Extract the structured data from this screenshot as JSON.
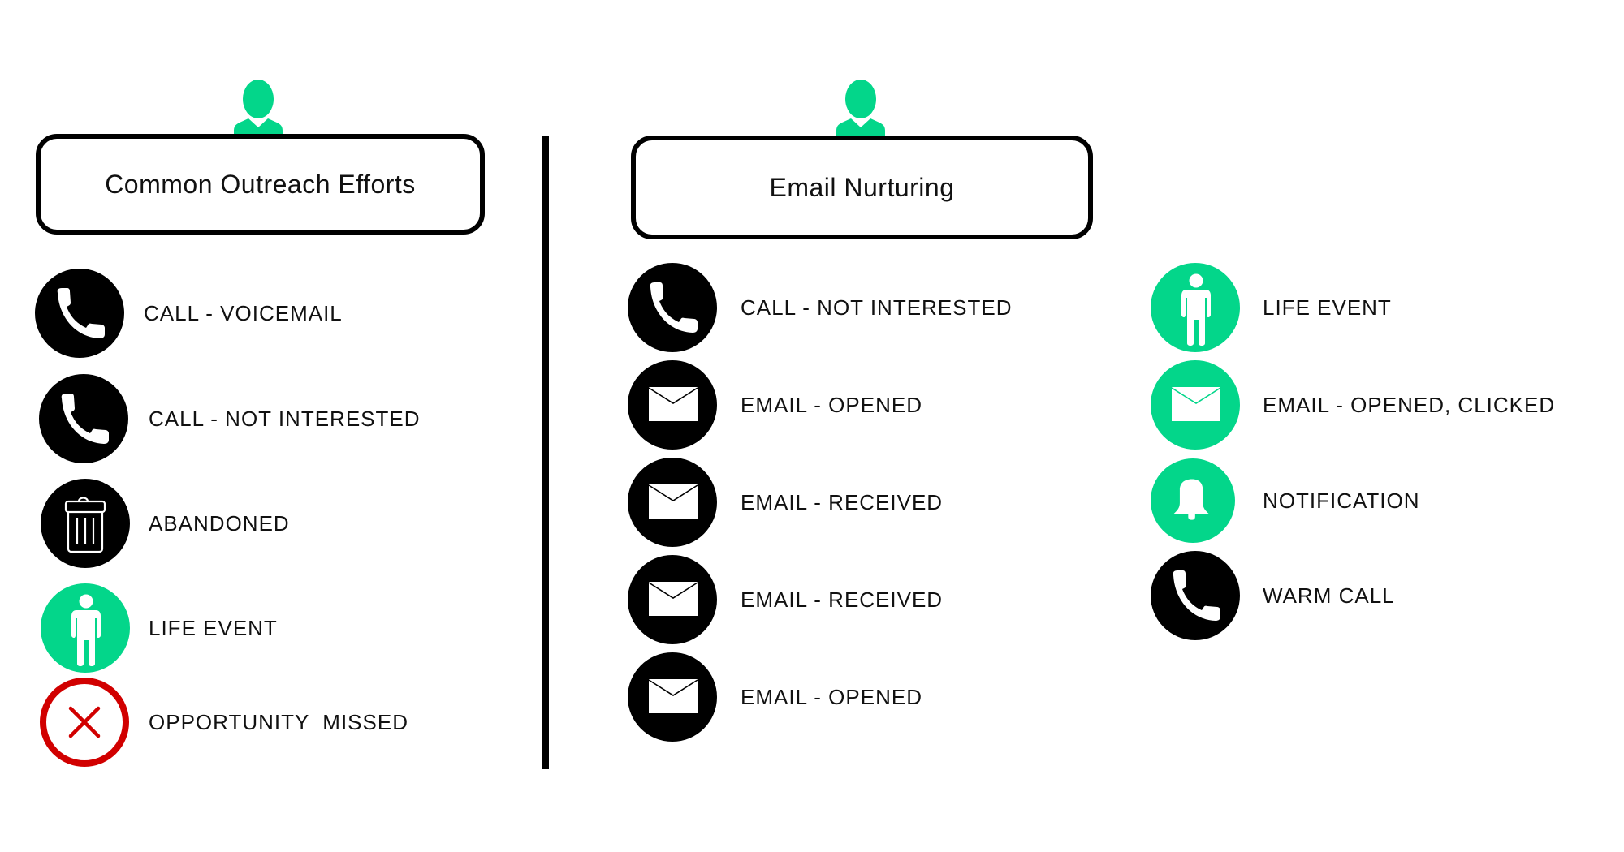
{
  "colors": {
    "accent_green": "#03d68a",
    "black": "#000000",
    "missed_red": "#d10000"
  },
  "sections": [
    {
      "title": "Common Outreach Efforts",
      "header_icon": "user-avatar-icon",
      "items": [
        {
          "label": "CALL - VOICEMAIL",
          "icon": "phone-icon",
          "style": "black"
        },
        {
          "label": "CALL - NOT INTERESTED",
          "icon": "phone-icon",
          "style": "black"
        },
        {
          "label": "ABANDONED",
          "icon": "trash-icon",
          "style": "black"
        },
        {
          "label": "LIFE EVENT",
          "icon": "person-icon",
          "style": "green"
        },
        {
          "label": "OPPORTUNITY  MISSED",
          "icon": "close-x-icon",
          "style": "red-outline"
        }
      ]
    },
    {
      "title": "Email Nurturing",
      "header_icon": "user-avatar-icon",
      "items": [
        {
          "label": "CALL - NOT INTERESTED",
          "icon": "phone-icon",
          "style": "black"
        },
        {
          "label": "EMAIL - OPENED",
          "icon": "envelope-icon",
          "style": "black"
        },
        {
          "label": "EMAIL - RECEIVED",
          "icon": "envelope-icon",
          "style": "black"
        },
        {
          "label": "EMAIL - RECEIVED",
          "icon": "envelope-icon",
          "style": "black"
        },
        {
          "label": "EMAIL - OPENED",
          "icon": "envelope-icon",
          "style": "black"
        },
        {
          "label": "LIFE EVENT",
          "icon": "person-icon",
          "style": "green"
        },
        {
          "label": "EMAIL - OPENED, CLICKED",
          "icon": "envelope-icon",
          "style": "green"
        },
        {
          "label": "NOTIFICATION",
          "icon": "bell-icon",
          "style": "green"
        },
        {
          "label": "WARM CALL",
          "icon": "phone-icon",
          "style": "black"
        }
      ]
    }
  ]
}
